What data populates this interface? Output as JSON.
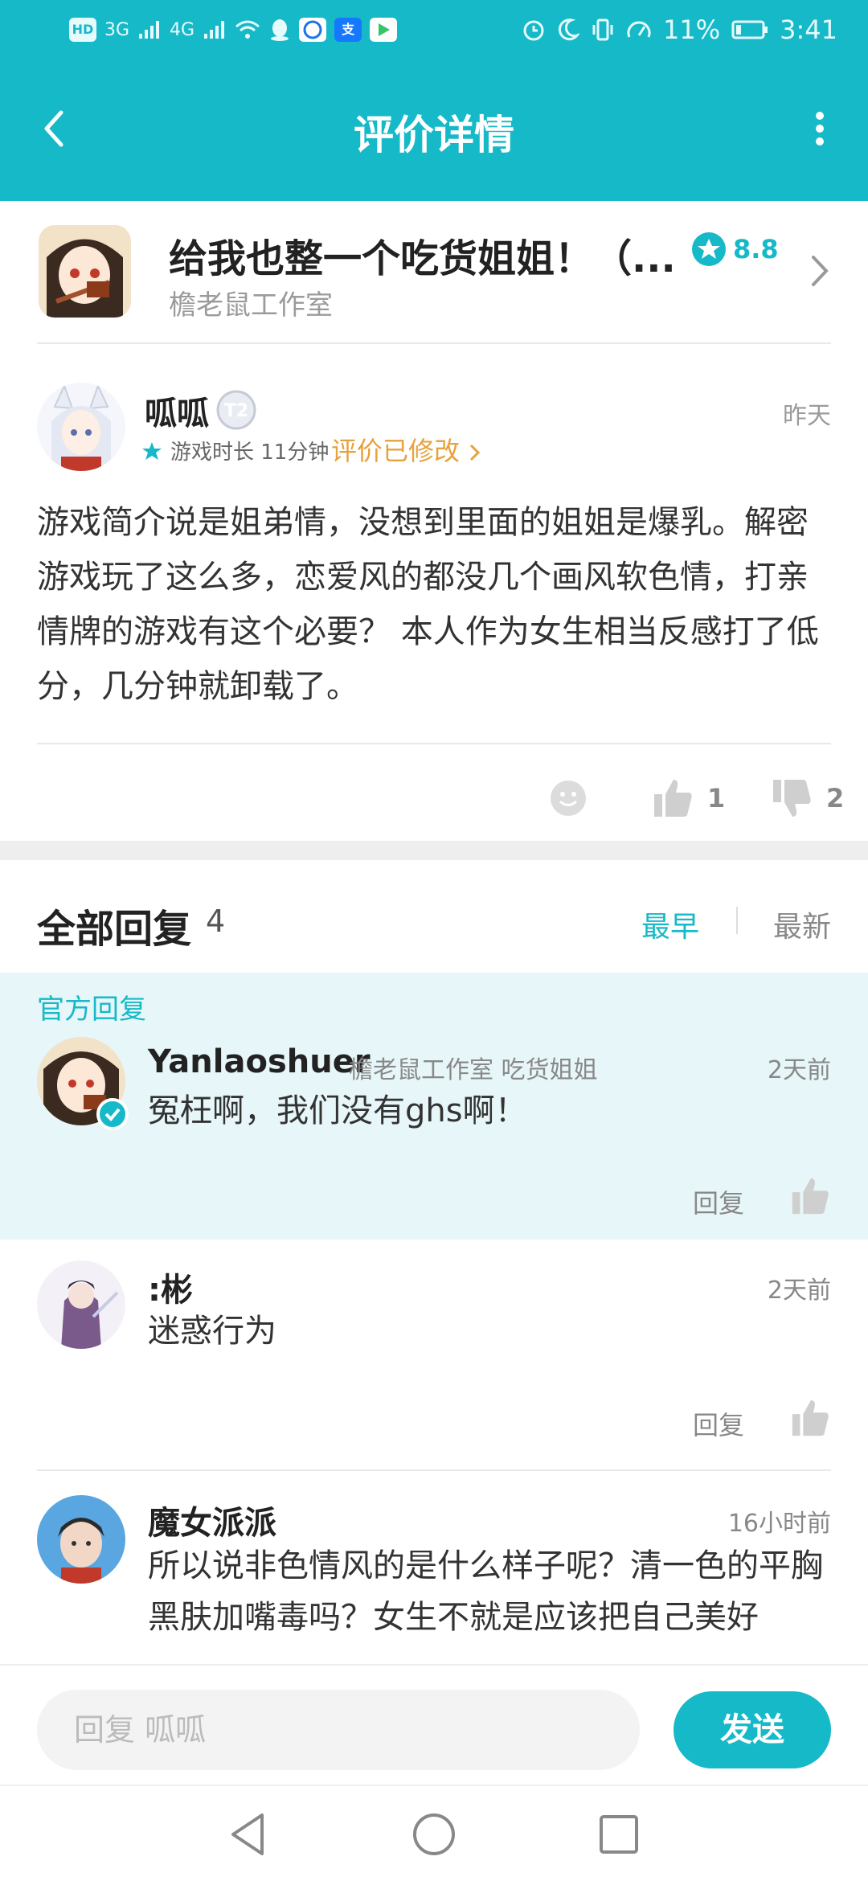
{
  "status_bar": {
    "network_labels": [
      "HD",
      "3G",
      "4G"
    ],
    "battery_percent": "11%",
    "time": "3:41"
  },
  "header": {
    "title": "评价详情",
    "icons": {
      "back": "back-arrow-icon",
      "more": "more-vertical-icon"
    }
  },
  "game": {
    "title": "给我也整一个吃货姐姐！（...",
    "developer": "檐老鼠工作室",
    "rating": "8.8"
  },
  "review": {
    "user": "呱呱",
    "level": "T2",
    "time": "昨天",
    "play_time": "游戏时长 11分钟",
    "edited": "评价已修改",
    "text": "游戏简介说是姐弟情，没想到里面的姐姐是爆乳。解密游戏玩了这么多，恋爱风的都没几个画风软色情，打亲情牌的游戏有这个必要？ 本人作为女生相当反感打了低分，几分钟就卸载了。",
    "likes": "1",
    "dislikes": "2"
  },
  "replies_header": {
    "title": "全部回复",
    "count": "4",
    "sort_earliest": "最早",
    "sort_latest": "最新"
  },
  "official_tag": "官方回复",
  "replies": [
    {
      "user": "Yanlaoshuer",
      "extra": "檐老鼠工作室 吃货姐姐",
      "time": "2天前",
      "text": "冤枉啊，我们没有ghs啊！",
      "reply_label": "回复"
    },
    {
      "user": ":彬",
      "time": "2天前",
      "text": "迷惑行为",
      "reply_label": "回复"
    },
    {
      "user": "魔女派派",
      "time": "16小时前",
      "text": "所以说非色情风的是什么样子呢？清一色的平胸黑肤加嘴毒吗？女生不就是应该把自己美好"
    }
  ],
  "input": {
    "placeholder": "回复 呱呱",
    "send_label": "发送"
  },
  "colors": {
    "accent": "#16b9c8",
    "edited": "#e6a23c",
    "official_bg": "#e7f6f8"
  }
}
